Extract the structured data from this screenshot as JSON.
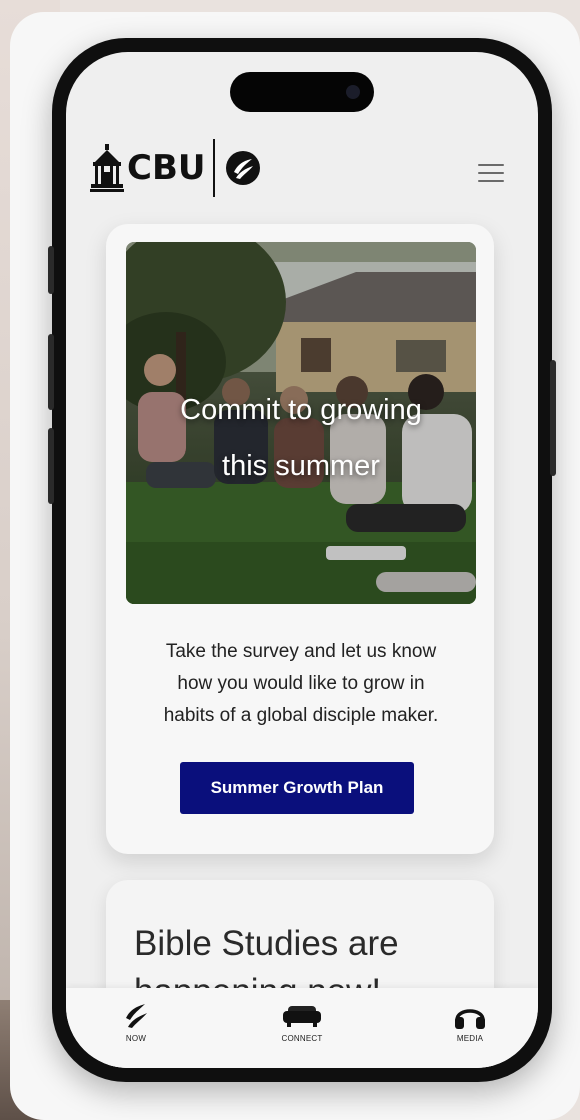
{
  "header": {
    "logo_text": "CBU",
    "menu_icon": "hamburger-menu-icon"
  },
  "feature_card": {
    "hero_title_line1": "Commit to growing",
    "hero_title_line2": "this summer",
    "body_line1": "Take the survey and let us know",
    "body_line2": "how you would like to grow in",
    "body_line3": "habits of a global disciple maker.",
    "cta_label": "Summer Growth Plan",
    "cta_color": "#0a0f7c"
  },
  "next_card": {
    "title_line1": "Bible Studies are",
    "title_line2": "happening now!"
  },
  "bottom_nav": {
    "items": [
      {
        "label": "NOW",
        "icon": "flame-swirl-icon"
      },
      {
        "label": "CONNECT",
        "icon": "couch-icon"
      },
      {
        "label": "MEDIA",
        "icon": "headphones-icon"
      }
    ]
  }
}
